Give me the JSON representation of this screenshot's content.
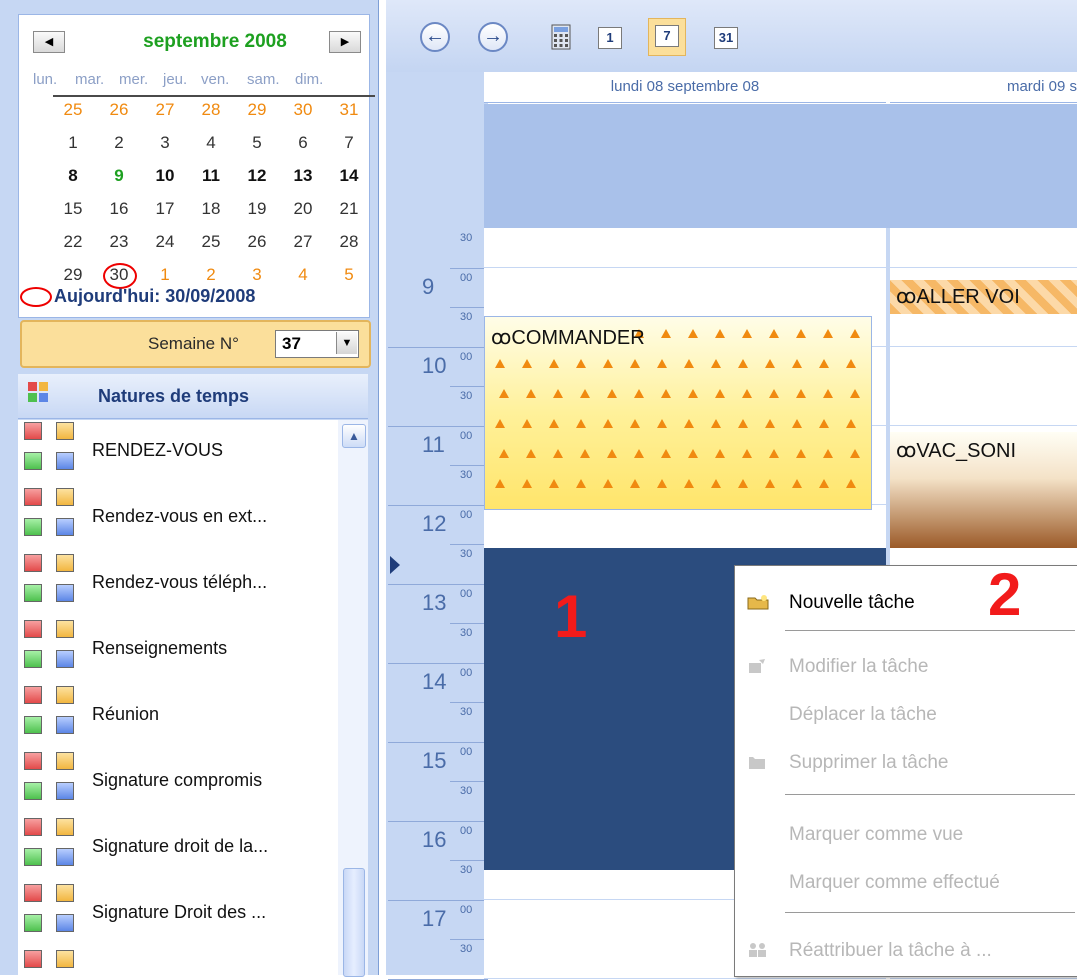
{
  "calendar": {
    "prev_label": "◀",
    "next_label": "▶",
    "month_title": "septembre 2008",
    "weekdays": [
      "lun.",
      "mar.",
      "mer.",
      "jeu.",
      "ven.",
      "sam.",
      "dim."
    ],
    "weeks": [
      [
        "25",
        "26",
        "27",
        "28",
        "29",
        "30",
        "31"
      ],
      [
        "1",
        "2",
        "3",
        "4",
        "5",
        "6",
        "7"
      ],
      [
        "8",
        "9",
        "10",
        "11",
        "12",
        "13",
        "14"
      ],
      [
        "15",
        "16",
        "17",
        "18",
        "19",
        "20",
        "21"
      ],
      [
        "22",
        "23",
        "24",
        "25",
        "26",
        "27",
        "28"
      ],
      [
        "29",
        "30",
        "1",
        "2",
        "3",
        "4",
        "5"
      ]
    ],
    "today_label": "Aujourd'hui: 30/09/2008"
  },
  "week": {
    "label": "Semaine N°",
    "value": "37"
  },
  "natures": {
    "title": "Natures de temps",
    "items": [
      "RENDEZ-VOUS",
      "Rendez-vous en ext...",
      "Rendez-vous téléph...",
      "Renseignements",
      "Réunion",
      "Signature compromis",
      "Signature droit de la...",
      "Signature Droit des ..."
    ]
  },
  "toolbar": {
    "back_icon": "back-arrow-icon",
    "forward_icon": "forward-arrow-icon",
    "calc_icon": "calculator-icon",
    "day_view": "1",
    "week_view": "7",
    "month_view": "31"
  },
  "agenda": {
    "days": [
      "lundi 08 septembre 08",
      "mardi 09 s"
    ],
    "hours": [
      "9",
      "10",
      "11",
      "12",
      "13",
      "14",
      "15",
      "16",
      "17"
    ],
    "min_00": "00",
    "min_30": "30",
    "events": {
      "commander": "COMMANDER",
      "aller": "ALLER VOI",
      "vac": "VAC_SONI"
    },
    "annotation_1": "1",
    "annotation_2": "2"
  },
  "context_menu": {
    "items": [
      {
        "label": "Nouvelle tâche",
        "enabled": true
      },
      {
        "label": "Modifier la tâche",
        "enabled": false
      },
      {
        "label": "Déplacer la tâche",
        "enabled": false
      },
      {
        "label": "Supprimer la tâche",
        "enabled": false
      },
      {
        "label": "Marquer comme vue",
        "enabled": false
      },
      {
        "label": "Marquer comme effectué",
        "enabled": false
      },
      {
        "label": "Réattribuer la tâche à ...",
        "enabled": false
      }
    ]
  },
  "colors": {
    "accent_green": "#1da020",
    "other_month": "#f08a10",
    "selection": "#2b4c7e",
    "annotation_red": "#f21b1b"
  }
}
